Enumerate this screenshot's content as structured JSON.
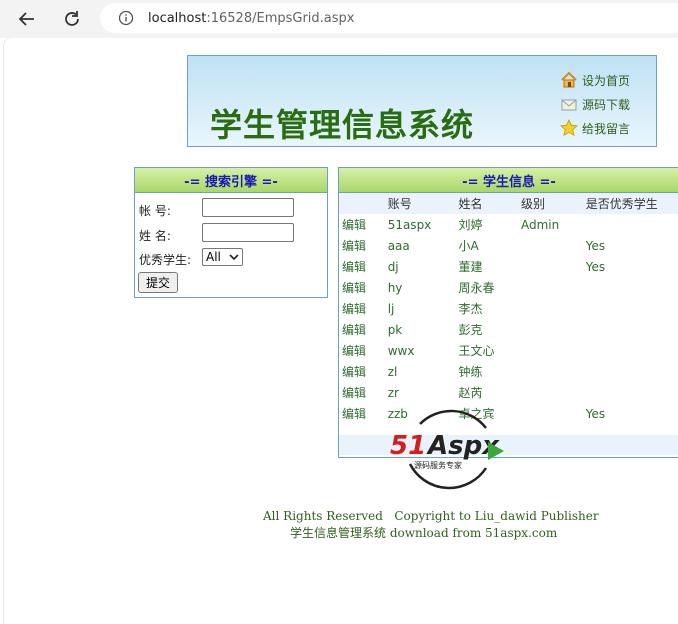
{
  "browser": {
    "url_host": "localhost",
    "url_rest": ":16528/EmpsGrid.aspx"
  },
  "banner": {
    "title": "学生管理信息系统",
    "links": [
      "设为首页",
      "源码下载",
      "给我留言"
    ]
  },
  "search": {
    "header": "-= 搜索引擎 =-",
    "account_label": "帐  号:",
    "name_label": "姓  名:",
    "excellent_label": "优秀学生:",
    "excellent_value": "All",
    "submit_label": "提交"
  },
  "grid": {
    "header": "-= 学生信息 =-",
    "columns": [
      "",
      "账号",
      "姓名",
      "级别",
      "是否优秀学生"
    ],
    "rows": [
      [
        "编辑",
        "51aspx",
        "刘婷",
        "Admin",
        ""
      ],
      [
        "编辑",
        "aaa",
        "小A",
        "",
        "Yes"
      ],
      [
        "编辑",
        "dj",
        "董建",
        "",
        "Yes"
      ],
      [
        "编辑",
        "hy",
        "周永春",
        "",
        ""
      ],
      [
        "编辑",
        "lj",
        "李杰",
        "",
        ""
      ],
      [
        "编辑",
        "pk",
        "彭克",
        "",
        ""
      ],
      [
        "编辑",
        "wwx",
        "王文心",
        "",
        ""
      ],
      [
        "编辑",
        "zl",
        "钟练",
        "",
        ""
      ],
      [
        "编辑",
        "zr",
        "赵芮",
        "",
        ""
      ],
      [
        "编辑",
        "zzb",
        "卓之宾",
        "",
        "Yes"
      ]
    ]
  },
  "watermark": {
    "brand_51": "51",
    "brand_aspx": "Aspx",
    "tagline": "源码服务专家"
  },
  "footer": {
    "line1": "All Rights Reserved   Copyright to Liu_dawid Publisher",
    "line2": "学生信息管理系统 download from 51aspx.com"
  }
}
